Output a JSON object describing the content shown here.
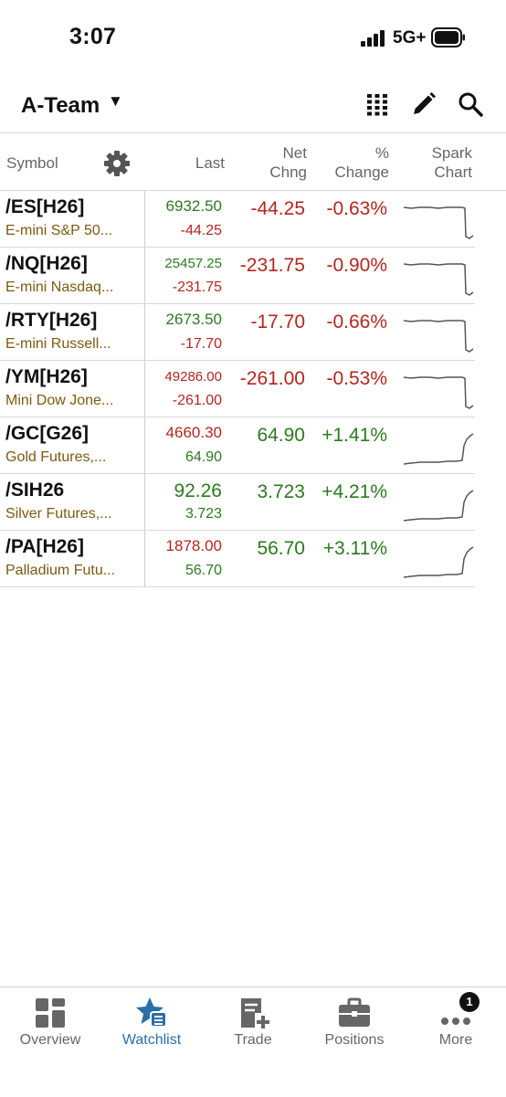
{
  "status_bar": {
    "time": "3:07",
    "network": "5G+"
  },
  "header": {
    "watchlist_name": "A-Team"
  },
  "columns": {
    "symbol": "Symbol",
    "last": "Last",
    "net_chng_1": "Net",
    "net_chng_2": "Chng",
    "pct_change_1": "%",
    "pct_change_2": "Change",
    "spark_1": "Spark",
    "spark_2": "Chart"
  },
  "rows": [
    {
      "symbol": "/ES[H26]",
      "description": "E-mini S&P 50...",
      "last": "6932.50",
      "last_change": "-44.25",
      "net_change": "-44.25",
      "pct_change": "-0.63%",
      "last_color": "green",
      "chg_color": "red",
      "trend": "down"
    },
    {
      "symbol": "/NQ[H26]",
      "description": "E-mini Nasdaq...",
      "last": "25457.25",
      "last_change": "-231.75",
      "net_change": "-231.75",
      "pct_change": "-0.90%",
      "last_color": "green",
      "chg_color": "red",
      "trend": "down"
    },
    {
      "symbol": "/RTY[H26]",
      "description": "E-mini Russell...",
      "last": "2673.50",
      "last_change": "-17.70",
      "net_change": "-17.70",
      "pct_change": "-0.66%",
      "last_color": "green",
      "chg_color": "red",
      "trend": "down"
    },
    {
      "symbol": "/YM[H26]",
      "description": "Mini Dow Jone...",
      "last": "49286.00",
      "last_change": "-261.00",
      "net_change": "-261.00",
      "pct_change": "-0.53%",
      "last_color": "red",
      "chg_color": "red",
      "trend": "down"
    },
    {
      "symbol": "/GC[G26]",
      "description": "Gold Futures,...",
      "last": "4660.30",
      "last_change": "64.90",
      "net_change": "64.90",
      "pct_change": "+1.41%",
      "last_color": "red",
      "chg_color": "green",
      "trend": "up"
    },
    {
      "symbol": "/SIH26",
      "description": "Silver Futures,...",
      "last": "92.26",
      "last_change": "3.723",
      "net_change": "3.723",
      "pct_change": "+4.21%",
      "last_color": "green",
      "chg_color": "green",
      "trend": "up"
    },
    {
      "symbol": "/PA[H26]",
      "description": "Palladium Futu...",
      "last": "1878.00",
      "last_change": "56.70",
      "net_change": "56.70",
      "pct_change": "+3.11%",
      "last_color": "red",
      "chg_color": "green",
      "trend": "up"
    }
  ],
  "nav": {
    "overview": "Overview",
    "watchlist": "Watchlist",
    "trade": "Trade",
    "positions": "Positions",
    "more": "More",
    "more_badge": "1"
  },
  "colors": {
    "red": "#b3261e",
    "green": "#2b7a1f",
    "accent": "#2a6fa8",
    "description": "#7b5a10"
  }
}
